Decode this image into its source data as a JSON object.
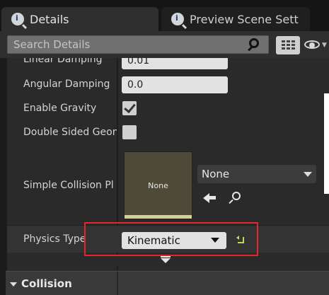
{
  "tabs": [
    {
      "label": "Details",
      "icon": "details-icon",
      "active": true
    },
    {
      "label": "Preview Scene Sett",
      "icon": "details-icon",
      "active": false
    }
  ],
  "search": {
    "placeholder": "Search Details",
    "value": ""
  },
  "properties": {
    "linear_damping": {
      "label": "Linear Damping",
      "value": "0.01"
    },
    "angular_damping": {
      "label": "Angular Damping",
      "value": "0.0"
    },
    "enable_gravity": {
      "label": "Enable Gravity",
      "checked": true
    },
    "double_sided": {
      "label": "Double Sided Geon",
      "checked": false
    },
    "simple_collision": {
      "label": "Simple Collision Pl",
      "thumbnail_text": "None",
      "selected": "None"
    },
    "physics_type": {
      "label": "Physics Type",
      "selected": "Kinematic"
    }
  },
  "categories": {
    "collision": {
      "label": "Collision"
    }
  },
  "colors": {
    "highlight": "#e8242c",
    "reset_arrow": "#c8d84a",
    "thumbnail": "#4d4a37"
  }
}
